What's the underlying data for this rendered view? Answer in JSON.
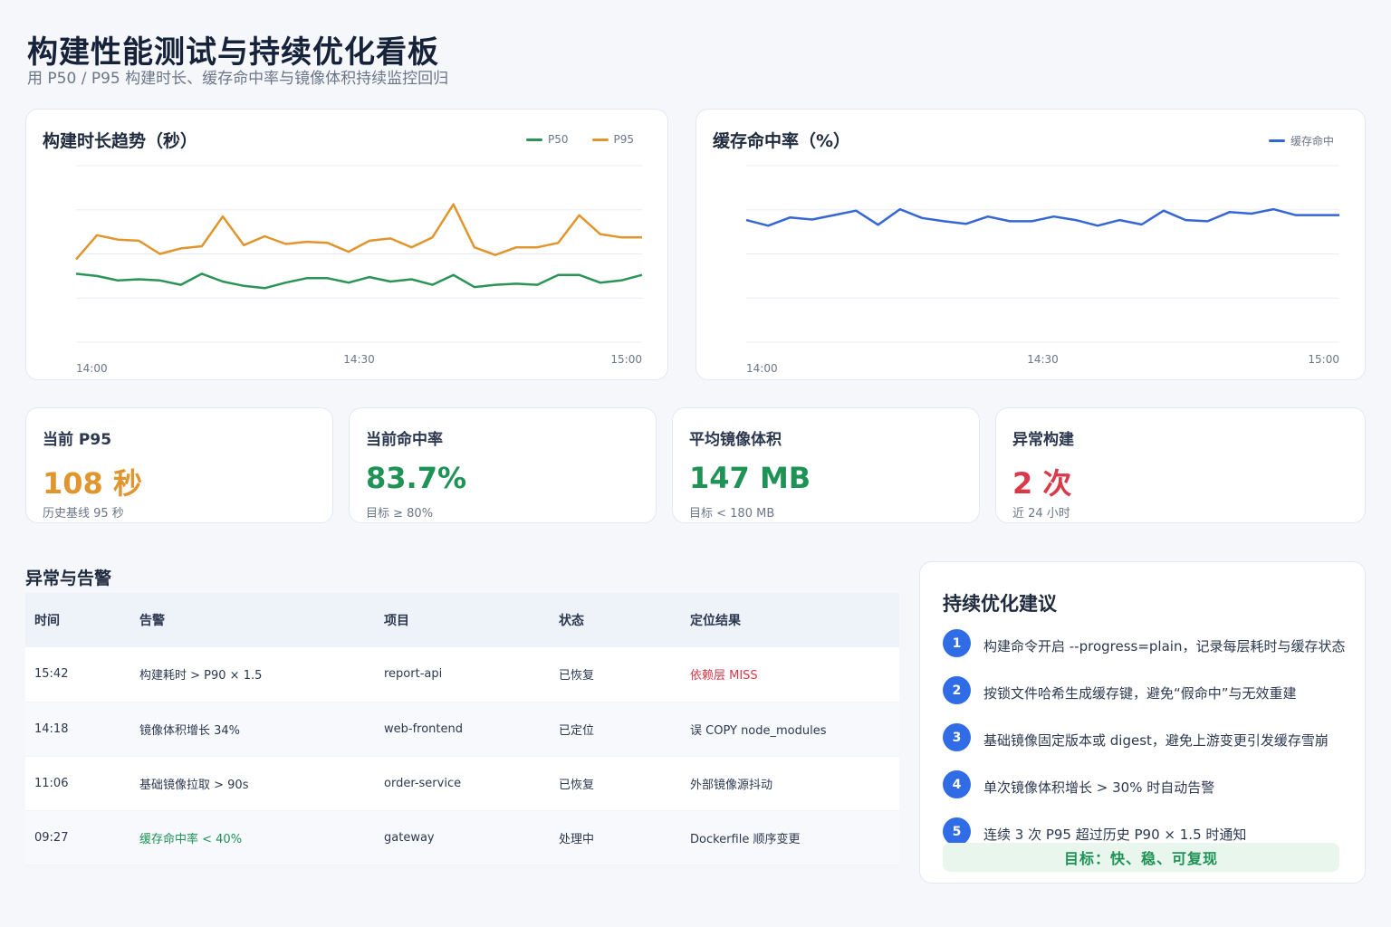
{
  "header": {
    "title": "构建性能测试与持续优化看板",
    "subtitle": "用 P50 / P95 构建时长、缓存命中率与镜像体积持续监控回归"
  },
  "colors": {
    "p50": "#2a9457",
    "p95": "#e0952f",
    "cache": "#3566d6",
    "orange": "#e0952f",
    "green": "#1f9255",
    "red": "#d93a4a",
    "blue_badge": "#2f6ce6"
  },
  "chart_data": [
    {
      "type": "line",
      "title": "构建时长趋势（秒）",
      "x_ticks": [
        "14:00",
        "14:30",
        "15:00"
      ],
      "series": [
        {
          "name": "P50",
          "values": [
            62,
            60,
            56,
            57,
            56,
            52,
            62,
            55,
            51,
            49,
            54,
            58,
            58,
            54,
            59,
            55,
            57,
            52,
            61,
            50,
            52,
            53,
            52,
            61,
            61,
            54,
            56,
            61
          ]
        },
        {
          "name": "P95",
          "values": [
            75,
            97,
            93,
            92,
            80,
            85,
            87,
            114,
            88,
            96,
            89,
            91,
            90,
            82,
            92,
            94,
            86,
            95,
            125,
            86,
            79,
            86,
            86,
            90,
            115,
            98,
            95,
            95
          ]
        }
      ],
      "ylim": [
        0,
        160
      ],
      "grid": true,
      "legend": "top-right"
    },
    {
      "type": "line",
      "title": "缓存命中率（%）",
      "x_ticks": [
        "14:00",
        "14:30",
        "15:00"
      ],
      "series": [
        {
          "name": "缓存命中",
          "values": [
            81.5,
            79.6,
            82.4,
            81.7,
            83.2,
            84.7,
            79.9,
            85.2,
            82.2,
            81.1,
            80.2,
            82.7,
            81.1,
            81.1,
            82.7,
            81.5,
            79.6,
            81.5,
            80,
            84.7,
            81.5,
            81.1,
            84.2,
            83.7,
            85.2,
            83.2,
            83.2,
            83.2
          ]
        }
      ],
      "ylim": [
        40,
        100
      ],
      "grid": true,
      "legend": "top-right"
    }
  ],
  "kpis": [
    {
      "label": "当前 P95",
      "value": "108 秒",
      "note": "历史基线 95 秒",
      "color": "#e0952f"
    },
    {
      "label": "当前命中率",
      "value": "83.7%",
      "note": "目标 ≥ 80%",
      "color": "#1f9255"
    },
    {
      "label": "平均镜像体积",
      "value": "147 MB",
      "note": "目标 < 180 MB",
      "color": "#1f9255"
    },
    {
      "label": "异常构建",
      "value": "2 次",
      "note": "近 24 小时",
      "color": "#d93a4a"
    }
  ],
  "alerts": {
    "section_title": "异常与告警",
    "columns": [
      "时间",
      "告警",
      "项目",
      "状态",
      "定位结果"
    ],
    "rows": [
      {
        "time": "15:42",
        "alert": "构建耗时 > P90 × 1.5",
        "project": "report-api",
        "status": "已恢复",
        "result": "依赖层 MISS"
      },
      {
        "time": "14:18",
        "alert": "镜像体积增长 34%",
        "project": "web-frontend",
        "status": "已定位",
        "result": "误 COPY node_modules"
      },
      {
        "time": "11:06",
        "alert": "基础镜像拉取 > 90s",
        "project": "order-service",
        "status": "已恢复",
        "result": "外部镜像源抖动"
      },
      {
        "time": "09:27",
        "alert": "缓存命中率 < 40%",
        "project": "gateway",
        "status": "处理中",
        "result": "Dockerfile 顺序变更"
      }
    ]
  },
  "suggestions": {
    "title": "持续优化建议",
    "items": [
      {
        "num": "1",
        "text": "构建命令开启 --progress=plain，记录每层耗时与缓存状态"
      },
      {
        "num": "2",
        "text": "按锁文件哈希生成缓存键，避免“假命中”与无效重建"
      },
      {
        "num": "3",
        "text": "基础镜像固定版本或 digest，避免上游变更引发缓存雪崩"
      },
      {
        "num": "4",
        "text": "单次镜像体积增长 > 30% 时自动告警"
      },
      {
        "num": "5",
        "text": "连续 3 次 P95 超过历史 P90 × 1.5 时通知"
      }
    ],
    "goal": "目标：快、稳、可复现"
  }
}
